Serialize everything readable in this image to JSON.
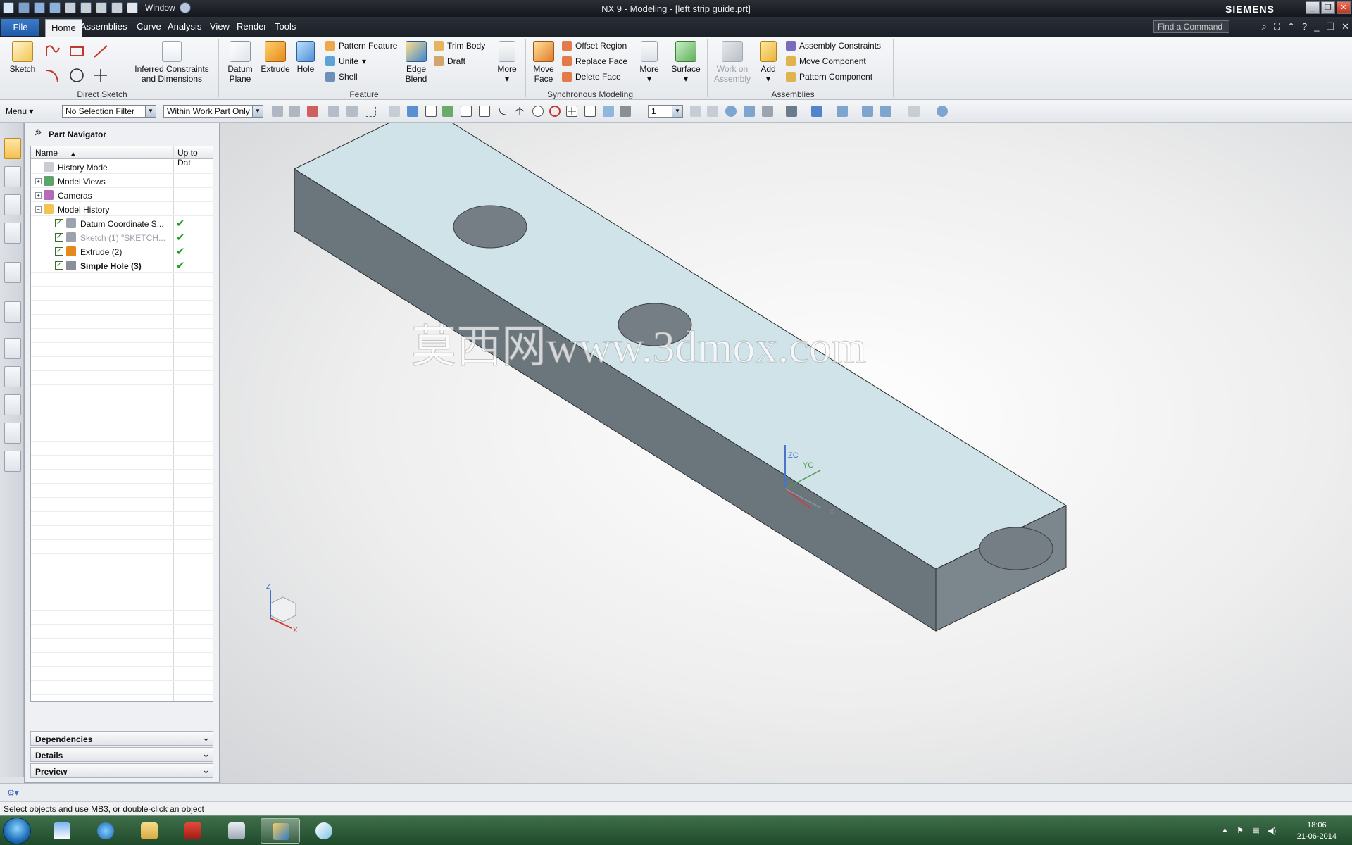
{
  "window": {
    "title": "NX 9 - Modeling - [left strip guide.prt]",
    "brand": "SIEMENS",
    "window_menu": "Window"
  },
  "tabs": {
    "file": "File",
    "items": [
      "Home",
      "Assemblies",
      "Curve",
      "Analysis",
      "View",
      "Render",
      "Tools"
    ],
    "active": "Home",
    "find_placeholder": "Find a Command"
  },
  "ribbon": {
    "sketch": "Sketch",
    "inferred": [
      "Inferred Constraints",
      "and Dimensions"
    ],
    "group_direct_sketch": "Direct Sketch",
    "datum_plane": [
      "Datum",
      "Plane"
    ],
    "extrude": "Extrude",
    "hole": "Hole",
    "pattern_feature": "Pattern Feature",
    "unite": "Unite",
    "shell": "Shell",
    "edge_blend": [
      "Edge",
      "Blend"
    ],
    "trim_body": "Trim Body",
    "draft": "Draft",
    "more1": "More",
    "group_feature": "Feature",
    "move_face": [
      "Move",
      "Face"
    ],
    "offset_region": "Offset Region",
    "replace_face": "Replace Face",
    "delete_face": "Delete Face",
    "more2": "More",
    "group_sync": "Synchronous Modeling",
    "surface": "Surface",
    "work_on_assembly": [
      "Work on",
      "Assembly"
    ],
    "add": "Add",
    "assembly_constraints": "Assembly Constraints",
    "move_component": "Move Component",
    "pattern_component": "Pattern Component",
    "group_assemblies": "Assemblies"
  },
  "selbar": {
    "menu": "Menu",
    "filter": "No Selection Filter",
    "scope": "Within Work Part Only",
    "layer": "1"
  },
  "navigator": {
    "title": "Part Navigator",
    "col_name": "Name",
    "col_uptodate": "Up to Dat",
    "rows": [
      {
        "label": "History Mode",
        "level": 0,
        "expander": "",
        "ok": ""
      },
      {
        "label": "Model Views",
        "level": 0,
        "expander": "+",
        "ok": ""
      },
      {
        "label": "Cameras",
        "level": 0,
        "expander": "+",
        "ok": ""
      },
      {
        "label": "Model History",
        "level": 0,
        "expander": "−",
        "ok": ""
      },
      {
        "label": "Datum Coordinate S...",
        "level": 1,
        "expander": "",
        "ok": "✔"
      },
      {
        "label": "Sketch (1) \"SKETCH...",
        "level": 1,
        "expander": "",
        "ok": "✔",
        "dim": true
      },
      {
        "label": "Extrude (2)",
        "level": 1,
        "expander": "",
        "ok": "✔"
      },
      {
        "label": "Simple Hole (3)",
        "level": 1,
        "expander": "",
        "ok": "✔",
        "bold": true
      }
    ],
    "panels": [
      "Dependencies",
      "Details",
      "Preview"
    ]
  },
  "viewport": {
    "watermark": "莫西网www.3dmox.com",
    "csys_labels": {
      "zc": "ZC",
      "yc": "YC",
      "xc": "X"
    },
    "triad_labels": {
      "z": "Z",
      "x": "X"
    },
    "colors": {
      "top_face": "#cfe3e8",
      "side_face": "#6a757c",
      "front_face": "#7b868d",
      "hole": "#747e84"
    }
  },
  "status": {
    "message": "Select objects and use MB3, or double-click an object"
  },
  "taskbar": {
    "time": "18:06",
    "date": "21-06-2014"
  }
}
